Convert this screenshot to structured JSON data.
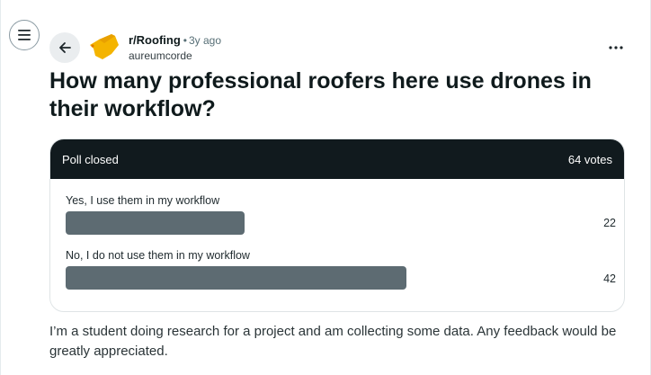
{
  "post": {
    "subreddit": "r/Roofing",
    "separator": "•",
    "age": "3y ago",
    "author": "aureumcorde",
    "title": "How many professional roofers here use drones in their workflow?",
    "body": "I’m a student doing research for a project and am collecting some data. Any feedback would be greatly appreciated."
  },
  "poll": {
    "status": "Poll closed",
    "votes": "64 votes",
    "total": 64,
    "options": [
      {
        "label": "Yes, I use them in my workflow",
        "count": "22",
        "value": 22
      },
      {
        "label": "No, I do not use them in my workflow",
        "count": "42",
        "value": 42
      }
    ]
  },
  "icons": {
    "menu": "hamburger-icon",
    "back": "arrow-left-icon",
    "avatar": "subreddit-avatar-icon",
    "more": "more-horizontal-icon"
  },
  "colors": {
    "poll_header_bg": "#111a1e",
    "poll_bar": "#5d6b72",
    "avatar_yellow": "#f4b400"
  }
}
